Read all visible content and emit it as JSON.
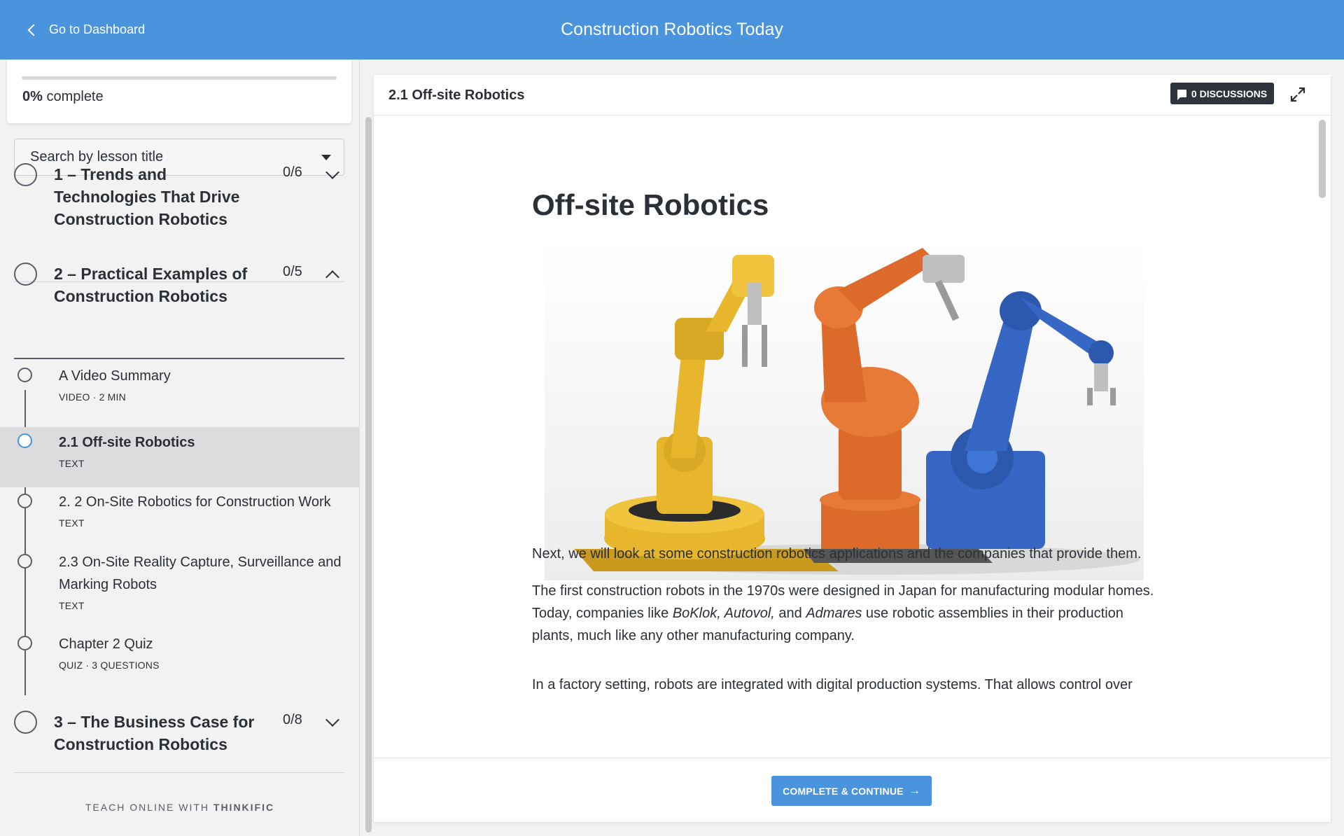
{
  "header": {
    "back_label": "Go to Dashboard",
    "course_title": "Construction Robotics Today"
  },
  "sidebar": {
    "progress": {
      "percent_label": "0%",
      "suffix": " complete",
      "value": 0
    },
    "search": {
      "placeholder": "Search by lesson title"
    },
    "chapters": [
      {
        "title": "1 – Trends and Technologies That Drive Construction Robotics",
        "count": "0/6",
        "expanded": false
      },
      {
        "title": "2 – Practical Examples of Construction Robotics",
        "count": "0/5",
        "expanded": true
      },
      {
        "title": "3 – The Business Case for Construction Robotics",
        "count": "0/8",
        "expanded": false
      }
    ],
    "lessons": [
      {
        "title": "A Video Summary",
        "meta": "VIDEO · 2 MIN"
      },
      {
        "title": "2.1 Off-site Robotics",
        "meta": "TEXT",
        "active": true
      },
      {
        "title": "2. 2 On-Site Robotics for Construction Work",
        "meta": "TEXT"
      },
      {
        "title": "2.3 On-Site Reality Capture, Surveillance and Marking Robots",
        "meta": "TEXT"
      },
      {
        "title": "Chapter 2 Quiz",
        "meta": "QUIZ · 3 QUESTIONS"
      }
    ],
    "footer": {
      "prefix": "TEACH ONLINE WITH ",
      "brand": "THINKIFIC"
    }
  },
  "content": {
    "lesson_heading": "2.1 Off-site Robotics",
    "discussions_label": "0 DISCUSSIONS",
    "article_title": "Off-site Robotics",
    "paragraphs": {
      "p1": "Next, we will look at some construction robotics applications and the companies that provide them.",
      "p2_a": "The first construction robots in the 1970s were designed in Japan for manufacturing modular homes. Today, companies like ",
      "p2_b": "BoKlok, Autovol,",
      "p2_c": " and ",
      "p2_d": "Admares",
      "p2_e": " use robotic assemblies in their production plants, much like any other manufacturing company.",
      "p3": "In a factory setting, robots are integrated with digital production systems. That allows control over"
    },
    "cta_label": "COMPLETE & CONTINUE",
    "cta_arrow": "→"
  },
  "colors": {
    "brand_blue": "#4a93dd",
    "dark": "#2f343c",
    "robot_yellow": "#e8b62c",
    "robot_orange": "#dc6a2a",
    "robot_blue": "#3667c4"
  }
}
